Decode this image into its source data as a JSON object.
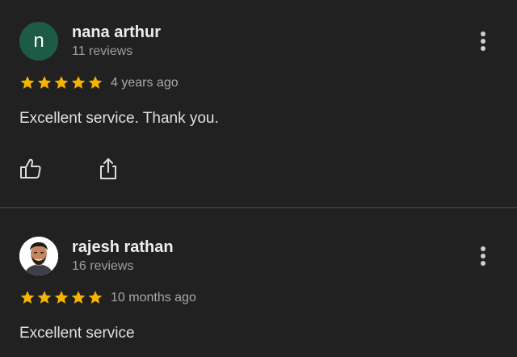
{
  "colors": {
    "background": "#212121",
    "star": "#f4b400",
    "avatar_n": "#1e5b47",
    "divider": "#3a3a3a"
  },
  "reviews": [
    {
      "avatar_letter": "n",
      "name": "nana arthur",
      "review_count": "11 reviews",
      "rating": 5,
      "date": "4 years ago",
      "text": "Excellent service. Thank you."
    },
    {
      "avatar_letter": "",
      "name": "rajesh rathan",
      "review_count": "16 reviews",
      "rating": 5,
      "date": "10 months ago",
      "text": "Excellent service"
    }
  ],
  "icons": {
    "more": "more-vert-icon",
    "like": "thumb-up-icon",
    "share": "share-icon",
    "star": "star-icon"
  }
}
